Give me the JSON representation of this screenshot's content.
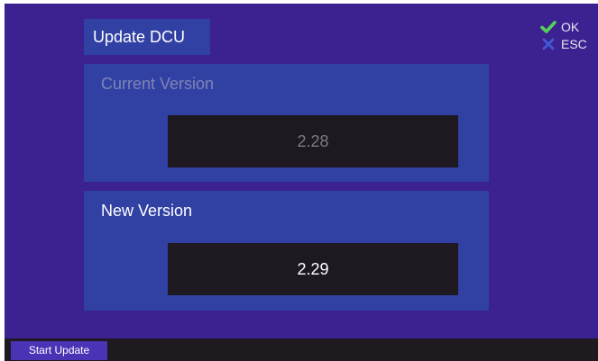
{
  "window": {
    "title": "Update DCU"
  },
  "softkeys": {
    "ok": {
      "label": "OK",
      "icon": "check-icon",
      "color": "#55d15b"
    },
    "esc": {
      "label": "ESC",
      "icon": "close-icon",
      "color": "#4658d4"
    }
  },
  "current_version": {
    "label": "Current Version",
    "value": "2.28"
  },
  "new_version": {
    "label": "New Version",
    "value": "2.29"
  },
  "footer": {
    "start_update_label": "Start Update"
  },
  "colors": {
    "background": "#3b2290",
    "panel": "#3140a3",
    "value_box": "#1e1821",
    "footer_bar": "#1f1920",
    "button": "#4a33b5"
  }
}
